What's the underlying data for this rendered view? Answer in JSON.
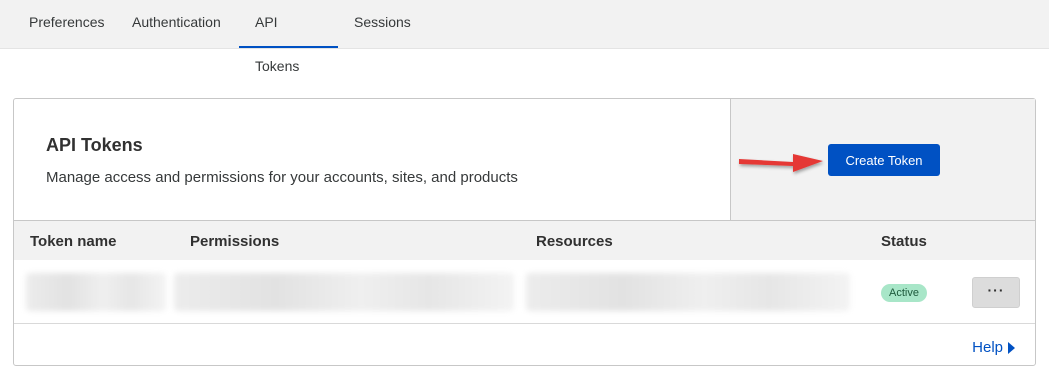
{
  "tabs": [
    {
      "label": "Preferences",
      "active": false
    },
    {
      "label": "Authentication",
      "active": false
    },
    {
      "label": "API Tokens",
      "active": true
    },
    {
      "label": "Sessions",
      "active": false
    }
  ],
  "card": {
    "title": "API Tokens",
    "description": "Manage access and permissions for your accounts, sites, and products",
    "create_button": "Create Token"
  },
  "table": {
    "columns": [
      "Token name",
      "Permissions",
      "Resources",
      "Status"
    ],
    "rows": [
      {
        "token_name": "",
        "permissions": "",
        "resources": "",
        "status": "Active",
        "more": "···"
      }
    ]
  },
  "footer": {
    "help_label": "Help"
  },
  "colors": {
    "accent": "#0051c3",
    "status_active_bg": "#a8e6c8",
    "annotation_arrow": "#e53935"
  },
  "icons": {
    "annotation": "red-arrow-icon",
    "help": "caret-right-icon",
    "more": "ellipsis-icon"
  }
}
